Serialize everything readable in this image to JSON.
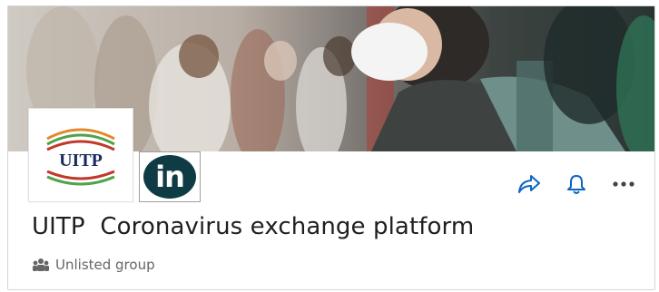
{
  "header": {
    "cover_alt": "cover-photo",
    "logo_text": "UITP",
    "badge_text": "in"
  },
  "group": {
    "title": "UITP  Coronavirus exchange platform",
    "visibility": "Unlisted group"
  },
  "actions": {
    "share_icon": "share-icon",
    "notify_icon": "bell-icon",
    "more_icon": "more-icon"
  },
  "colors": {
    "accent": "#0a66c2",
    "badge_bg": "#0f3b45",
    "uitp_red": "#c0392b",
    "uitp_green": "#4fa34a",
    "uitp_orange": "#e08a2b",
    "uitp_navy": "#1b2a5c"
  }
}
